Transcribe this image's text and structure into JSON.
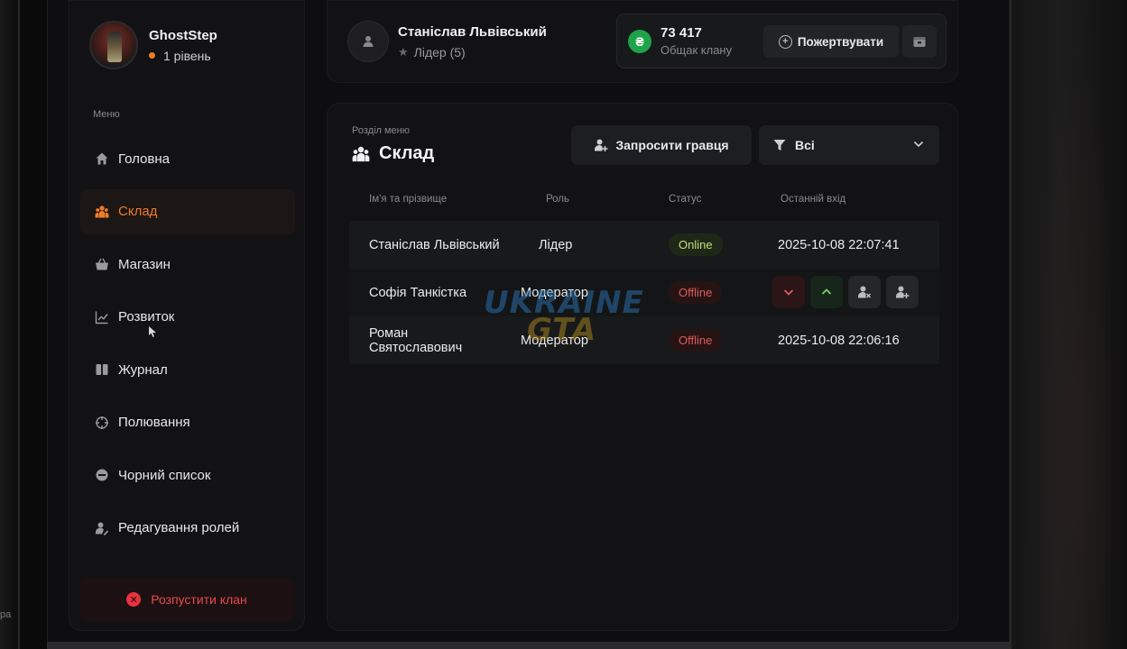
{
  "colors": {
    "accent": "#f07a2a",
    "danger": "#e84a4a",
    "success": "#1fa34a",
    "online": "#bfe07a",
    "offline": "#e05a5a"
  },
  "profile": {
    "name": "GhostStep",
    "level": "1 рівень"
  },
  "menu": {
    "label": "Меню",
    "items": [
      {
        "label": "Головна",
        "icon": "home-icon"
      },
      {
        "label": "Склад",
        "icon": "people-icon",
        "active": true
      },
      {
        "label": "Магазин",
        "icon": "basket-icon"
      },
      {
        "label": "Розвиток",
        "icon": "chart-line-icon"
      },
      {
        "label": "Журнал",
        "icon": "book-icon"
      },
      {
        "label": "Полювання",
        "icon": "crosshair-icon"
      },
      {
        "label": "Чорний список",
        "icon": "block-icon"
      },
      {
        "label": "Редагування ролей",
        "icon": "user-edit-icon"
      }
    ],
    "disband_label": "Розпустити клан"
  },
  "leader": {
    "name": "Станіслав Львівський",
    "role": "Лідер (5)"
  },
  "treasury": {
    "amount": "73 417",
    "label": "Общак клану",
    "currency_symbol": "₴",
    "donate_label": "Пожертвувати"
  },
  "section": {
    "subtitle": "Розділ меню",
    "title": "Склад",
    "invite_label": "Запросити гравця",
    "filter_value": "Всі"
  },
  "table": {
    "headers": [
      "Ім'я та прізвище",
      "Роль",
      "Статус",
      "Останній вхід"
    ],
    "rows": [
      {
        "name": "Станіслав Львівський",
        "role": "Лідер",
        "status": "Online",
        "last": "2025-10-08 22:07:41"
      },
      {
        "name": "Софія Танкістка",
        "role": "Модератор",
        "status": "Offline",
        "last": ""
      },
      {
        "name": "Роман Святославович",
        "role": "Модератор",
        "status": "Offline",
        "last": "2025-10-08 22:06:16"
      }
    ]
  },
  "watermark": {
    "line1": "UKRAINE",
    "line2": "GTA"
  },
  "left_note": "pa"
}
